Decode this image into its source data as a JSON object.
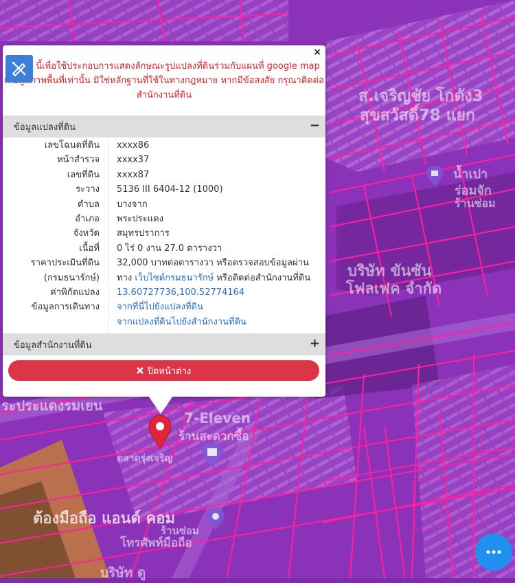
{
  "popup": {
    "notice_line1": "นี้เพื่อใช้ประกอบการแสดงลักษณะรูปแปลงที่ดินร่วมกับแผนที่ google map",
    "notice_line2": "เพื่อดูสภาพพื้นที่เท่านั้น มิใช่หลักฐานที่ใช้ในทางกฎหมาย หากมีข้อสงสัย กรุณาติดต่อ",
    "notice_line3": "สำนักงานที่ดิน",
    "close_symbol": "×",
    "parcel_section": {
      "title": "ข้อมูลแปลงที่ดิน",
      "toggle": "−",
      "rows": [
        {
          "label": "เลขโฉนดที่ดิน",
          "value": "xxxx86"
        },
        {
          "label": "หน้าสำรวจ",
          "value": "xxxx37"
        },
        {
          "label": "เลขที่ดิน",
          "value": "xxxx87"
        },
        {
          "label": "ระวาง",
          "value": "5136 III 6404-12 (1000)"
        },
        {
          "label": "ตำบล",
          "value": "บางจาก"
        },
        {
          "label": "อำเภอ",
          "value": "พระประแดง"
        },
        {
          "label": "จังหวัด",
          "value": "สมุทรปราการ"
        },
        {
          "label": "เนื้อที่",
          "value": "0 ไร่ 0 งาน 27.0 ตารางวา"
        },
        {
          "label": "ราคาประเมินที่ดิน",
          "value": "32,000 บาทต่อตารางวา หรือตรวจสอบข้อมูลผ่าน"
        },
        {
          "label": "(กรมธนารักษ์)",
          "value_prefix": "ทาง ",
          "value_link": "เว็บไซต์กรมธนารักษ์",
          "value_suffix": " หรือติดต่อสำนักงานที่ดิน"
        },
        {
          "label": "ค่าพิกัดแปลง",
          "value": "13.60727736,100.52774164"
        },
        {
          "label": "ข้อมูลการเดินทาง",
          "value": "จากที่นี่ไปยังแปลงที่ดิน"
        },
        {
          "label": "",
          "value": "จากแปลงที่ดินไปยังสำนักงานที่ดิน"
        }
      ]
    },
    "office_section": {
      "title": "ข้อมูลสำนักงานที่ดิน",
      "toggle": "+"
    },
    "close_button_label": "ปิดหน้าต่าง"
  },
  "map": {
    "labels": {
      "shop_top": "ส.เจริญชัย โกดัง3",
      "road_top": "สุขสวัสดิ์78 แยก",
      "water": "น้ำเปา",
      "shop_right1": "ร่อมจัก",
      "shop_right2": "ร้านซ่อม",
      "company1": "บริษัท ขันซัน",
      "company2": "โฟลเฟค จำกัด",
      "road_left": "ระประแดงรมเยน",
      "seven": "7-Eleven",
      "seven_sub": "ร้านสะดวกซื้อ",
      "marker_label": "ตลาดรุ่งเจริญ",
      "shop_bottom": "ต้องมือถือ แอนด์ คอม",
      "shop_bottom2": "ร้านซ่อม",
      "shop_bottom3": "โทรศัพท์มือถือ",
      "company_bottom": "บริษัท ดู"
    },
    "colors": {
      "overlay": "#8a32b8",
      "parcel_line": "#ff1fa0",
      "marker": "#e0253a"
    }
  }
}
